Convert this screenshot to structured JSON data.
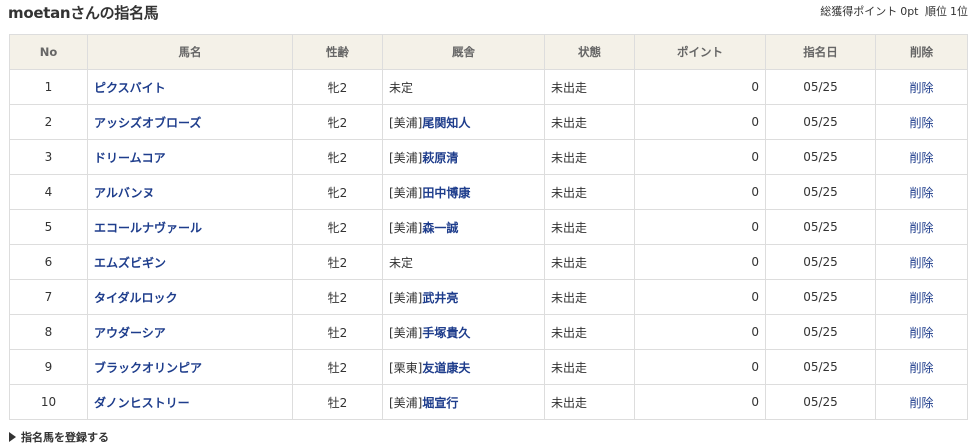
{
  "header": {
    "title": "moetanさんの指名馬",
    "total_points_label": "総獲得ポイント",
    "total_points": "0pt",
    "rank_label": "順位",
    "rank": "1位"
  },
  "table": {
    "columns": [
      "No",
      "馬名",
      "性齢",
      "厩舎",
      "状態",
      "ポイント",
      "指名日",
      "削除"
    ],
    "rows": [
      {
        "no": "1",
        "name": "ピクスバイト",
        "sex_age": "牝2",
        "stable_prefix": "",
        "trainer": "",
        "stable_plain": "未定",
        "status": "未出走",
        "points": "0",
        "date": "05/25",
        "delete": "削除"
      },
      {
        "no": "2",
        "name": "アッシズオブローズ",
        "sex_age": "牝2",
        "stable_prefix": "[美浦]",
        "trainer": "尾関知人",
        "stable_plain": "",
        "status": "未出走",
        "points": "0",
        "date": "05/25",
        "delete": "削除"
      },
      {
        "no": "3",
        "name": "ドリームコア",
        "sex_age": "牝2",
        "stable_prefix": "[美浦]",
        "trainer": "萩原清",
        "stable_plain": "",
        "status": "未出走",
        "points": "0",
        "date": "05/25",
        "delete": "削除"
      },
      {
        "no": "4",
        "name": "アルバンヌ",
        "sex_age": "牝2",
        "stable_prefix": "[美浦]",
        "trainer": "田中博康",
        "stable_plain": "",
        "status": "未出走",
        "points": "0",
        "date": "05/25",
        "delete": "削除"
      },
      {
        "no": "5",
        "name": "エコールナヴァール",
        "sex_age": "牝2",
        "stable_prefix": "[美浦]",
        "trainer": "森一誠",
        "stable_plain": "",
        "status": "未出走",
        "points": "0",
        "date": "05/25",
        "delete": "削除"
      },
      {
        "no": "6",
        "name": "エムズビギン",
        "sex_age": "牡2",
        "stable_prefix": "",
        "trainer": "",
        "stable_plain": "未定",
        "status": "未出走",
        "points": "0",
        "date": "05/25",
        "delete": "削除"
      },
      {
        "no": "7",
        "name": "タイダルロック",
        "sex_age": "牡2",
        "stable_prefix": "[美浦]",
        "trainer": "武井亮",
        "stable_plain": "",
        "status": "未出走",
        "points": "0",
        "date": "05/25",
        "delete": "削除"
      },
      {
        "no": "8",
        "name": "アウダーシア",
        "sex_age": "牡2",
        "stable_prefix": "[美浦]",
        "trainer": "手塚貴久",
        "stable_plain": "",
        "status": "未出走",
        "points": "0",
        "date": "05/25",
        "delete": "削除"
      },
      {
        "no": "9",
        "name": "ブラックオリンピア",
        "sex_age": "牡2",
        "stable_prefix": "[栗東]",
        "trainer": "友道康夫",
        "stable_plain": "",
        "status": "未出走",
        "points": "0",
        "date": "05/25",
        "delete": "削除"
      },
      {
        "no": "10",
        "name": "ダノンヒストリー",
        "sex_age": "牡2",
        "stable_prefix": "[美浦]",
        "trainer": "堀宣行",
        "stable_plain": "",
        "status": "未出走",
        "points": "0",
        "date": "05/25",
        "delete": "削除"
      }
    ]
  },
  "footer": {
    "register_icon": "triangle-right-icon",
    "register_label": "指名馬を登録する"
  }
}
